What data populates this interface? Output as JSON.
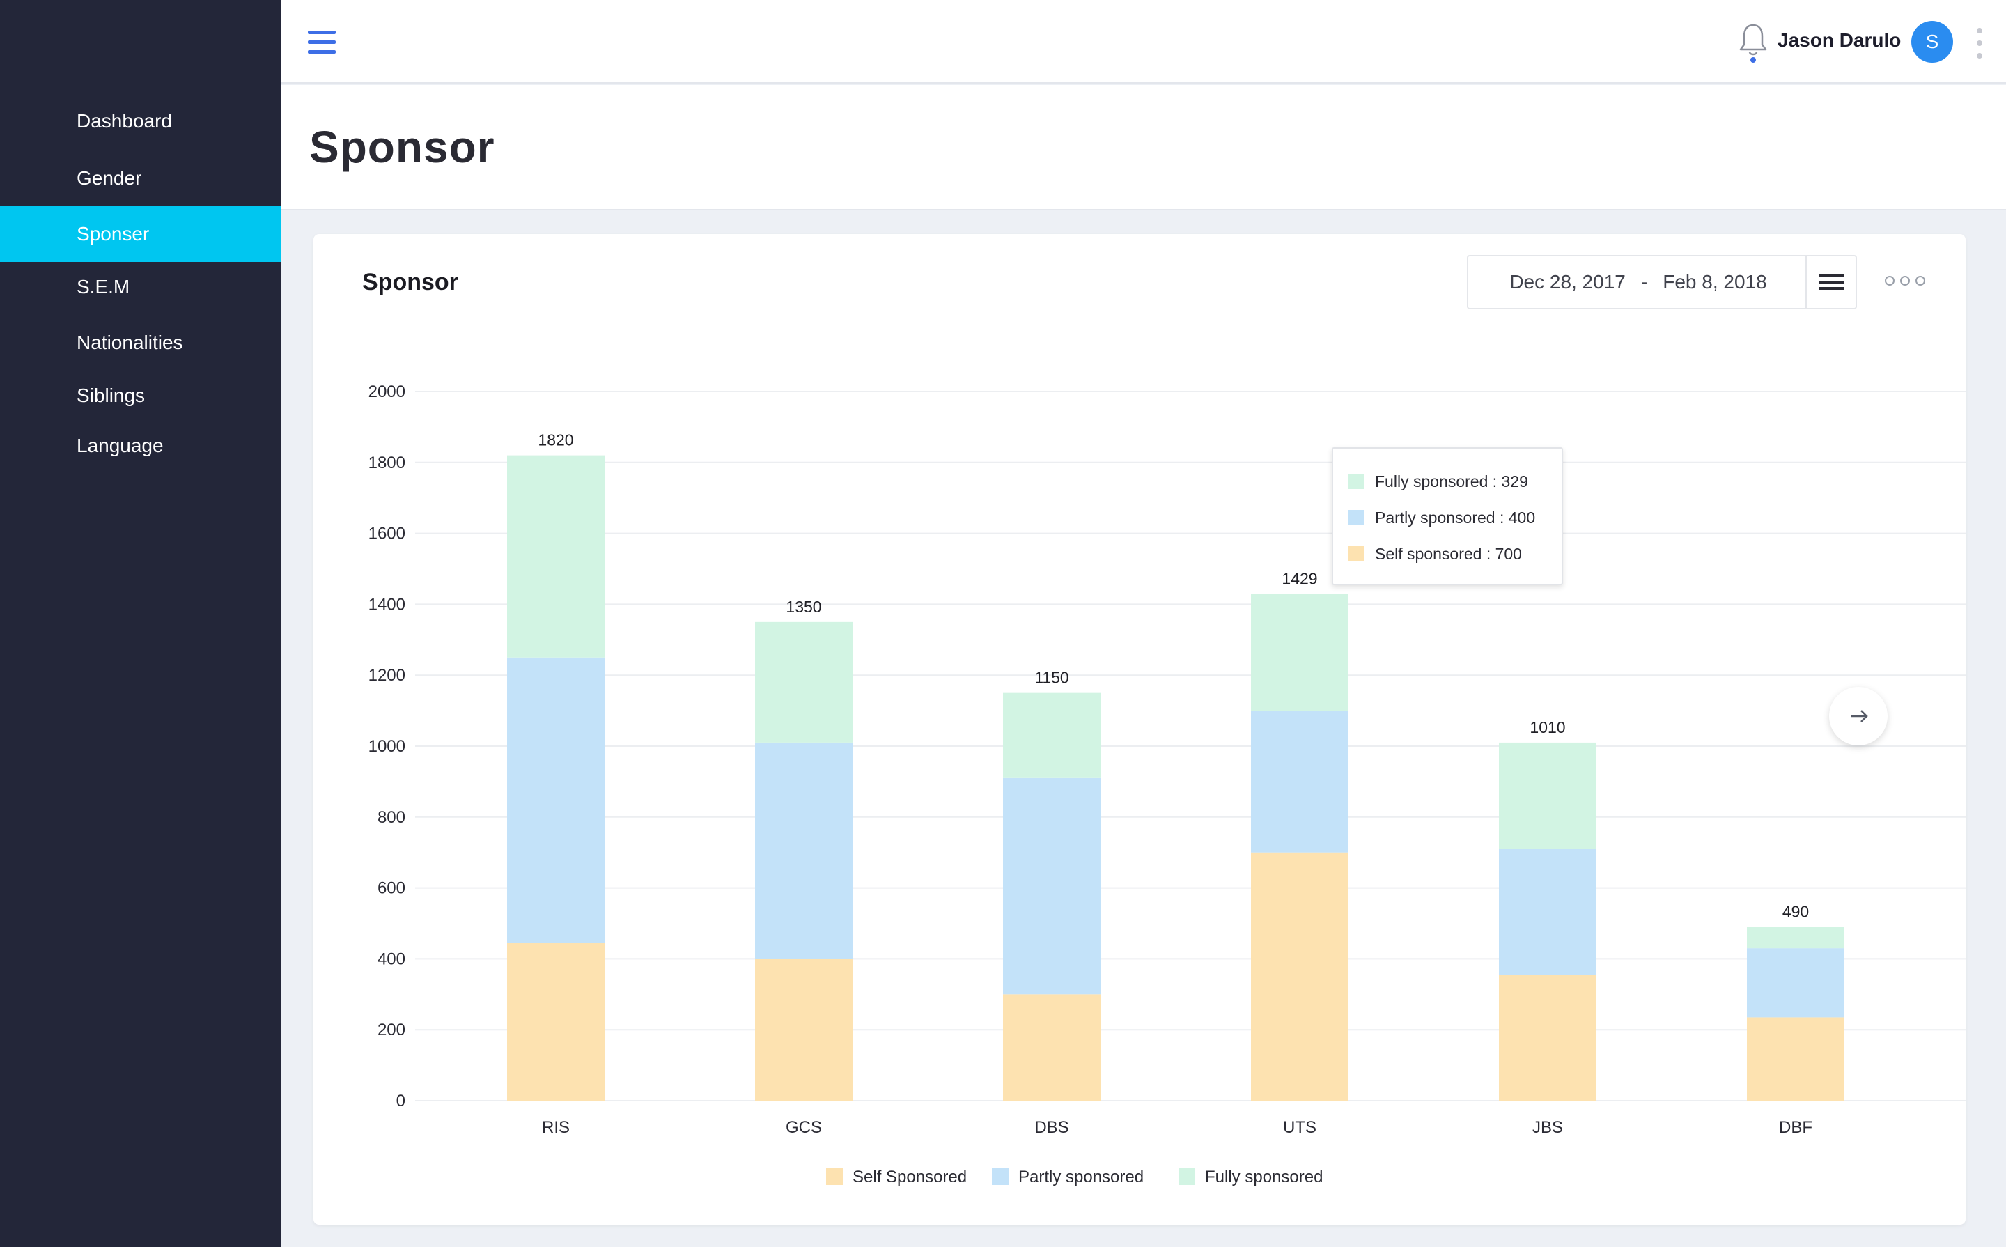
{
  "sidebar": {
    "items": [
      {
        "label": "Dashboard"
      },
      {
        "label": "Gender"
      },
      {
        "label": "Sponser"
      },
      {
        "label": "S.E.M"
      },
      {
        "label": "Nationalities"
      },
      {
        "label": "Siblings"
      },
      {
        "label": "Language"
      }
    ],
    "active_index": 2
  },
  "topbar": {
    "menu_icon": "hamburger-icon",
    "notification_icon": "bell-icon",
    "user_name": "Jason Darulo",
    "avatar_initial": "S",
    "more_icon": "vertical-dots-icon"
  },
  "page": {
    "title": "Sponsor"
  },
  "card": {
    "title": "Sponsor",
    "date_range": {
      "start": "Dec 28, 2017",
      "separator": "-",
      "end": "Feb 8, 2018"
    },
    "menu_icon": "hamburger-icon",
    "options_icon": "horizontal-dots-icon",
    "next_icon": "arrow-right-icon"
  },
  "colors": {
    "self": "#fde2b0",
    "partly": "#c3e2f9",
    "fully": "#d2f4e3",
    "accent": "#00c6f0",
    "sidebar_bg": "#232639"
  },
  "tooltip": {
    "rows": [
      {
        "label": "Fully sponsored : 329",
        "series": "fully"
      },
      {
        "label": "Partly sponsored : 400",
        "series": "partly"
      },
      {
        "label": "Self sponsored : 700",
        "series": "self"
      }
    ]
  },
  "chart_data": {
    "type": "bar",
    "stacked": true,
    "categories": [
      "RIS",
      "GCS",
      "DBS",
      "UTS",
      "JBS",
      "DBF"
    ],
    "series": [
      {
        "name": "Self Sponsored",
        "key": "self",
        "values": [
          445,
          400,
          300,
          700,
          355,
          235
        ]
      },
      {
        "name": "Partly sponsored",
        "key": "partly",
        "values": [
          805,
          610,
          610,
          400,
          355,
          195
        ]
      },
      {
        "name": "Fully sponsored",
        "key": "fully",
        "values": [
          570,
          340,
          240,
          329,
          300,
          60
        ]
      }
    ],
    "totals": [
      1820,
      1350,
      1150,
      1429,
      1010,
      490
    ],
    "ylim": [
      0,
      2000
    ],
    "yticks": [
      0,
      200,
      400,
      600,
      800,
      1000,
      1200,
      1400,
      1600,
      1800,
      2000
    ],
    "grid": true,
    "legend_position": "bottom",
    "title": "Sponsor",
    "xlabel": "",
    "ylabel": ""
  }
}
